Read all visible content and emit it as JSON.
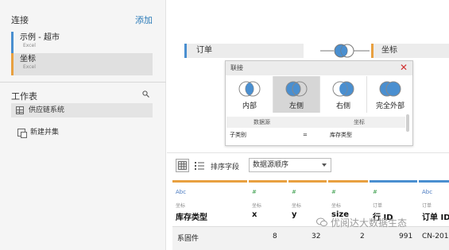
{
  "connections": {
    "title": "连接",
    "add_label": "添加",
    "items": [
      {
        "name": "示例 - 超市",
        "type": "Excel"
      },
      {
        "name": "坐标",
        "type": "Excel"
      }
    ]
  },
  "worksheets": {
    "title": "工作表",
    "items": [
      {
        "name": "供应链系统"
      }
    ],
    "new_union": "新建并集"
  },
  "canvas": {
    "left_table": "订单",
    "right_table": "坐标"
  },
  "join_dialog": {
    "title": "联接",
    "types": [
      {
        "label": "内部",
        "selected": false
      },
      {
        "label": "左侧",
        "selected": true
      },
      {
        "label": "右侧",
        "selected": false
      },
      {
        "label": "完全外部",
        "selected": false
      }
    ],
    "clause_header": {
      "left": "数据源",
      "right": "坐标"
    },
    "clause": {
      "left": "子类别",
      "op": "=",
      "right": "库存类型"
    }
  },
  "toolbar": {
    "sort_label": "排序字段",
    "sort_value": "数据源顺序"
  },
  "grid": {
    "columns": [
      {
        "type": "Abc",
        "source": "坐标",
        "name": "库存类型"
      },
      {
        "type": "#",
        "source": "坐标",
        "name": "x"
      },
      {
        "type": "#",
        "source": "坐标",
        "name": "y"
      },
      {
        "type": "#",
        "source": "坐标",
        "name": "size"
      },
      {
        "type": "#",
        "source": "订单",
        "name": "行 ID"
      },
      {
        "type": "Abc",
        "source": "订单",
        "name": "订单 ID"
      }
    ],
    "row": [
      "系固件",
      "8",
      "32",
      "2",
      "991",
      "CN-201"
    ]
  },
  "watermark": "优阅达大数据生态",
  "colors": {
    "left_accent": "#4a8fd0",
    "right_accent": "#e8a040",
    "close": "#d03030"
  }
}
